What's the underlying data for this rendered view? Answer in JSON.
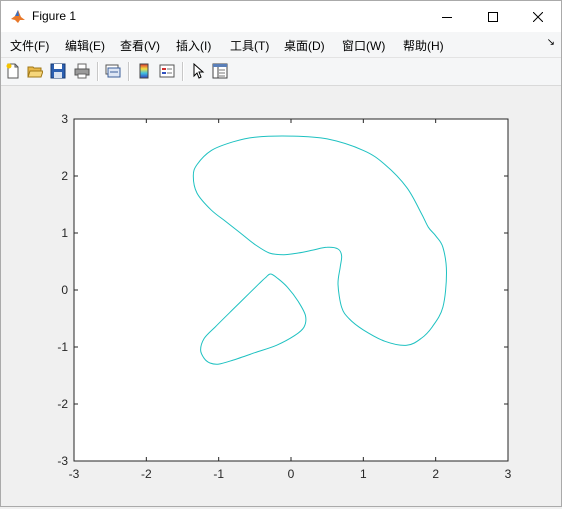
{
  "window": {
    "title": "Figure 1",
    "controls": {
      "minimize": "minimize",
      "maximize": "maximize",
      "close": "close"
    }
  },
  "menu": [
    "文件(F)",
    "编辑(E)",
    "查看(V)",
    "插入(I)",
    "工具(T)",
    "桌面(D)",
    "窗口(W)",
    "帮助(H)"
  ],
  "toolbar": [
    "new-figure-icon",
    "open-file-icon",
    "save-icon",
    "print-icon",
    "link-plot-icon",
    "colorbar-icon",
    "legend-icon",
    "pointer-icon",
    "property-inspector-icon"
  ],
  "chart_data": {
    "type": "line",
    "xlim": [
      -3,
      3
    ],
    "ylim": [
      -3,
      3
    ],
    "xticks": [
      "-3",
      "-2",
      "-1",
      "0",
      "1",
      "2",
      "3"
    ],
    "yticks": [
      "3",
      "2",
      "1",
      "0",
      "-1",
      "-2",
      "-3"
    ],
    "grid": false,
    "series": [
      {
        "color": "#1ec1c1",
        "x": [
          0.0,
          0.5,
          1.0,
          1.3,
          1.6,
          1.8,
          1.9,
          2.0,
          2.1,
          2.15,
          2.1,
          1.95,
          1.8,
          1.6,
          1.3,
          1.0,
          0.8,
          0.7,
          0.65,
          0.68,
          0.7,
          0.65,
          0.5,
          0.3,
          0.1,
          -0.1,
          -0.3,
          -0.5,
          -0.7,
          -0.9,
          -1.1,
          -1.3,
          -1.35,
          -1.3,
          -1.1,
          -0.8,
          -0.5,
          0.0
        ],
        "y": [
          2.7,
          2.65,
          2.45,
          2.2,
          1.8,
          1.35,
          1.1,
          0.95,
          0.75,
          0.3,
          -0.3,
          -0.65,
          -0.85,
          -0.97,
          -0.9,
          -0.7,
          -0.5,
          -0.3,
          0.1,
          0.4,
          0.6,
          0.72,
          0.75,
          0.7,
          0.65,
          0.62,
          0.65,
          0.8,
          1.0,
          1.2,
          1.4,
          1.7,
          2.0,
          2.2,
          2.45,
          2.6,
          2.68,
          2.7
        ]
      },
      {
        "color": "#1ec1c1",
        "x": [
          -0.28,
          -0.18,
          -0.05,
          0.1,
          0.2,
          0.18,
          0.05,
          -0.2,
          -0.5,
          -0.8,
          -1.0,
          -1.12,
          -1.2,
          -1.25,
          -1.2,
          -1.05,
          -0.85,
          -0.65,
          -0.45,
          -0.35,
          -0.28
        ],
        "y": [
          0.28,
          0.2,
          0.05,
          -0.2,
          -0.45,
          -0.65,
          -0.8,
          -0.97,
          -1.1,
          -1.23,
          -1.3,
          -1.28,
          -1.2,
          -1.05,
          -0.85,
          -0.65,
          -0.4,
          -0.15,
          0.1,
          0.22,
          0.28
        ]
      }
    ]
  }
}
